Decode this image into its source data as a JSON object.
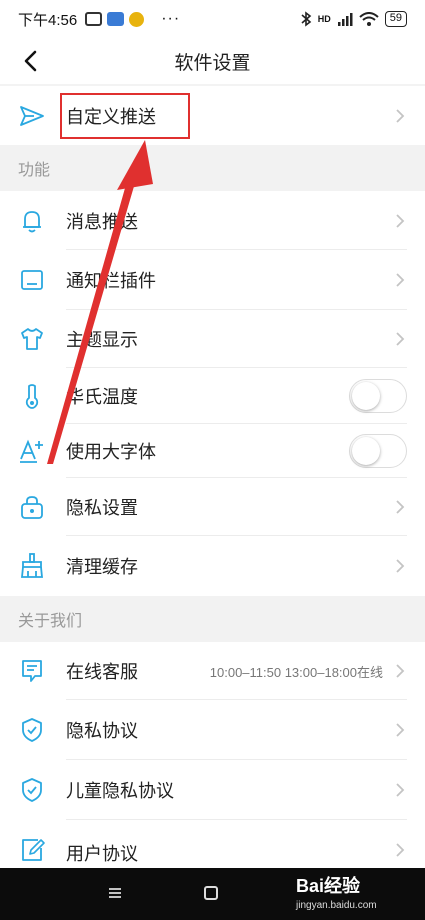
{
  "status": {
    "time": "下午4:56",
    "dots": "···",
    "network": "HD",
    "battery": "59"
  },
  "header": {
    "title": "软件设置"
  },
  "top_item": {
    "label": "自定义推送"
  },
  "sections": [
    {
      "title": "功能"
    },
    {
      "title": "关于我们"
    }
  ],
  "function_items": [
    {
      "label": "消息推送",
      "icon": "bell-icon"
    },
    {
      "label": "通知栏插件",
      "icon": "notification-bar-icon"
    },
    {
      "label": "主题显示",
      "icon": "shirt-icon"
    },
    {
      "label": "华氏温度",
      "icon": "thermometer-icon",
      "toggle": false
    },
    {
      "label": "使用大字体",
      "icon": "font-size-icon",
      "toggle": false
    },
    {
      "label": "隐私设置",
      "icon": "lock-icon"
    },
    {
      "label": "清理缓存",
      "icon": "broom-icon"
    }
  ],
  "about_items": [
    {
      "label": "在线客服",
      "icon": "chat-icon",
      "value": "10:00–11:50  13:00–18:00在线"
    },
    {
      "label": "隐私协议",
      "icon": "shield-icon"
    },
    {
      "label": "儿童隐私协议",
      "icon": "shield-icon"
    },
    {
      "label": "用户协议",
      "icon": "edit-doc-icon"
    }
  ],
  "watermark": {
    "brand": "Bai经验",
    "url": "jingyan.baidu.com"
  },
  "colors": {
    "accent": "#2aa8e0",
    "highlight": "#e0302f"
  }
}
